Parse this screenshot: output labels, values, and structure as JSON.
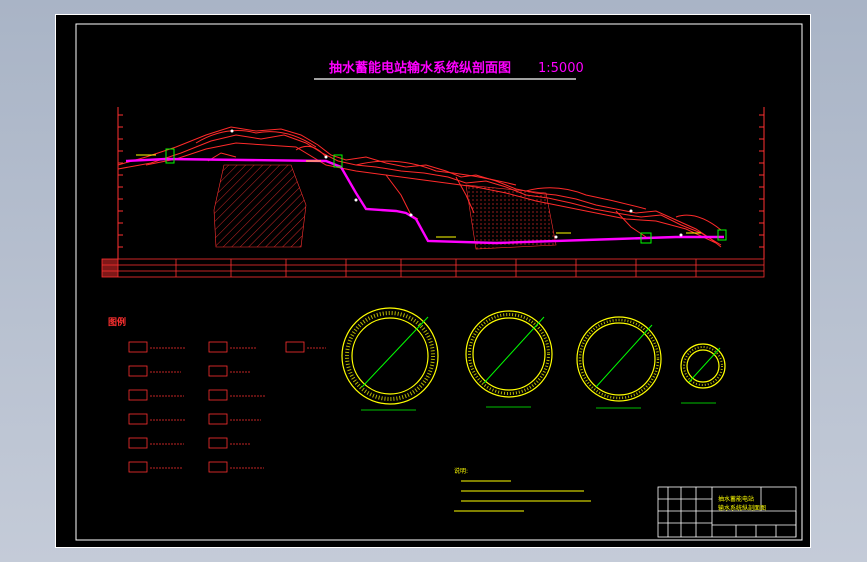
{
  "drawing": {
    "title": "抽水蓄能电站输水系统纵剖面图",
    "scale": "1:5000",
    "legend_heading": "图例",
    "notes_heading": "说明:",
    "title_block": {
      "line1": "抽水蓄能电站",
      "line2": "输水系统纵剖面图"
    }
  },
  "colors": {
    "background": "#000000",
    "frame": "#ffffff",
    "title": "#ff00ff",
    "terrain": "#ff2020",
    "tunnel": "#ff00ff",
    "sections": "#ffff00",
    "annotations": "#00ff00",
    "window_bg_top": "#a9b4c6"
  },
  "cross_sections": [
    {
      "name": "section-1",
      "ring": "thick"
    },
    {
      "name": "section-2",
      "ring": "thick"
    },
    {
      "name": "section-3",
      "ring": "medium"
    },
    {
      "name": "section-4",
      "ring": "thin"
    }
  ],
  "legend_rows": 6,
  "legend_columns": 3
}
